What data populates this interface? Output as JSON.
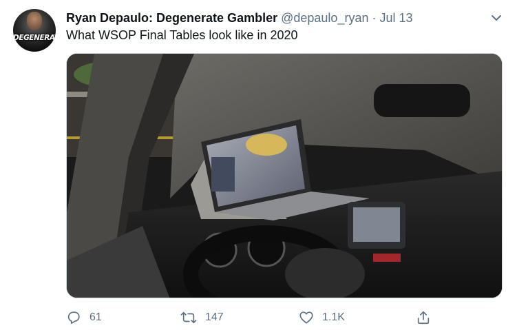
{
  "tweet": {
    "display_name": "Ryan Depaulo: Degenerate Gambler",
    "handle": "@depaulo_ryan",
    "separator": "·",
    "date": "Jul 13",
    "text": "What WSOP Final Tables look like in 2020",
    "avatar_label": "DEGENERATE"
  },
  "actions": {
    "reply_count": "61",
    "retweet_count": "147",
    "like_count": "1.1K"
  },
  "icons": {
    "reply": "reply-icon",
    "retweet": "retweet-icon",
    "like": "like-icon",
    "share": "share-icon",
    "more": "chevron-down-icon"
  },
  "colors": {
    "name": "#0f1419",
    "secondary": "#5b7083",
    "border": "#cfd9de"
  }
}
